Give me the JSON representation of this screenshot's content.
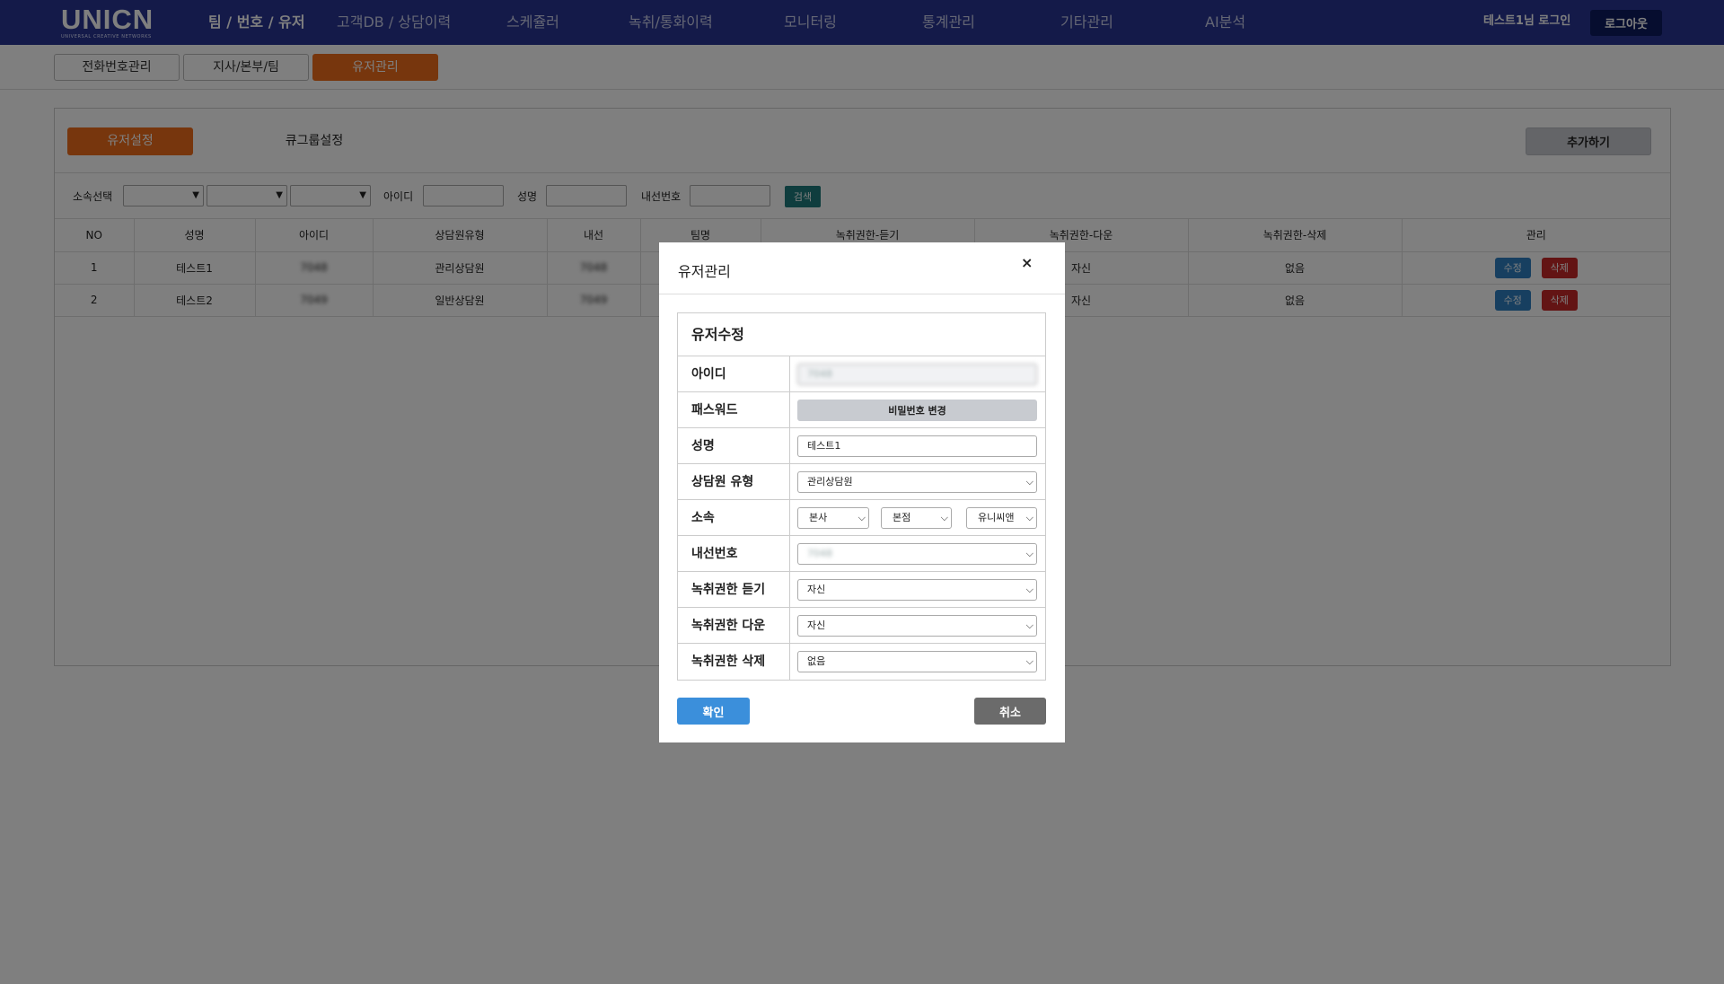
{
  "header": {
    "logo": "UNICN",
    "logo_sub": "UNIVERSAL CREATIVE NETWORKS",
    "nav": [
      "팀 / 번호 / 유저",
      "고객DB / 상담이력",
      "스케쥴러",
      "녹취/통화이력",
      "모니터링",
      "통계관리",
      "기타관리",
      "AI분석"
    ],
    "active_nav": "팀 / 번호 / 유저",
    "login_text": "테스트1님 로그인",
    "logout_label": "로그아웃"
  },
  "subtabs": [
    "전화번호관리",
    "지사/본부/팀",
    "유저관리"
  ],
  "active_subtab": "유저관리",
  "panel": {
    "tabs": [
      "유저설정",
      "큐그룹설정"
    ],
    "active_tab": "유저설정",
    "add_label": "추가하기",
    "filter": {
      "affiliation_label": "소속선택",
      "id_label": "아이디",
      "name_label": "성명",
      "ext_label": "내선번호",
      "search_label": "검색"
    },
    "columns": [
      "NO",
      "성명",
      "아이디",
      "상담원유형",
      "내선",
      "팀명",
      "녹취권한-듣기",
      "녹취권한-다운",
      "녹취권한-삭제",
      "관리"
    ],
    "rows": [
      {
        "no": "1",
        "name": "테스트1",
        "id": "7048",
        "type": "관리상담원",
        "ext": "7048",
        "team": "",
        "listen": "",
        "down": "자신",
        "delete": "없음"
      },
      {
        "no": "2",
        "name": "테스트2",
        "id": "7049",
        "type": "일반상담원",
        "ext": "7049",
        "team": "",
        "listen": "",
        "down": "자신",
        "delete": "없음"
      }
    ],
    "edit_label": "수정",
    "delete_label": "삭제"
  },
  "modal": {
    "title": "유저관리",
    "close_icon": "×",
    "form_title": "유저수정",
    "labels": {
      "id": "아이디",
      "password": "패스워드",
      "name": "성명",
      "type": "상담원 유형",
      "affiliation": "소속",
      "ext": "내선번호",
      "listen": "녹취권한 듣기",
      "down": "녹취권한 다운",
      "delete": "녹취권한 삭제"
    },
    "values": {
      "id": "7048",
      "password_button": "비밀번호 변경",
      "name": "테스트1",
      "type": "관리상담원",
      "branch": "본사",
      "hq": "본점",
      "team": "유니씨앤",
      "ext": "7048",
      "listen": "자신",
      "down": "자신",
      "delete": "없음"
    },
    "confirm_label": "확인",
    "cancel_label": "취소"
  },
  "colors": {
    "topbar": "#283593",
    "accent_orange": "#ef6c1a",
    "edit_blue": "#2f7fc1",
    "delete_red": "#c62828",
    "confirm_blue": "#3b8fdb",
    "cancel_gray": "#6b6b6b"
  }
}
